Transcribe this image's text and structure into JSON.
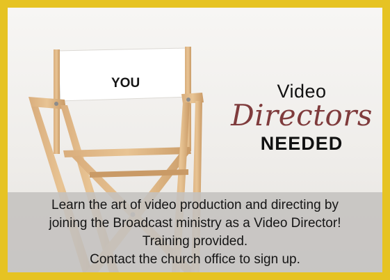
{
  "flyer": {
    "chair_label": "YOU",
    "headline": {
      "line1": "Video",
      "line2": "Directors",
      "line3": "NEEDED"
    },
    "body_lines": [
      "Learn the art of video production and directing by",
      "joining the Broadcast ministry as a Video Director!",
      "Training provided.",
      "Contact the church office to sign up."
    ]
  },
  "colors": {
    "border": "#e6c323",
    "directors_script": "#7f3b3c",
    "info_panel": "#c4c2bf"
  },
  "images": {
    "chair": "directors-chair-illustration"
  }
}
